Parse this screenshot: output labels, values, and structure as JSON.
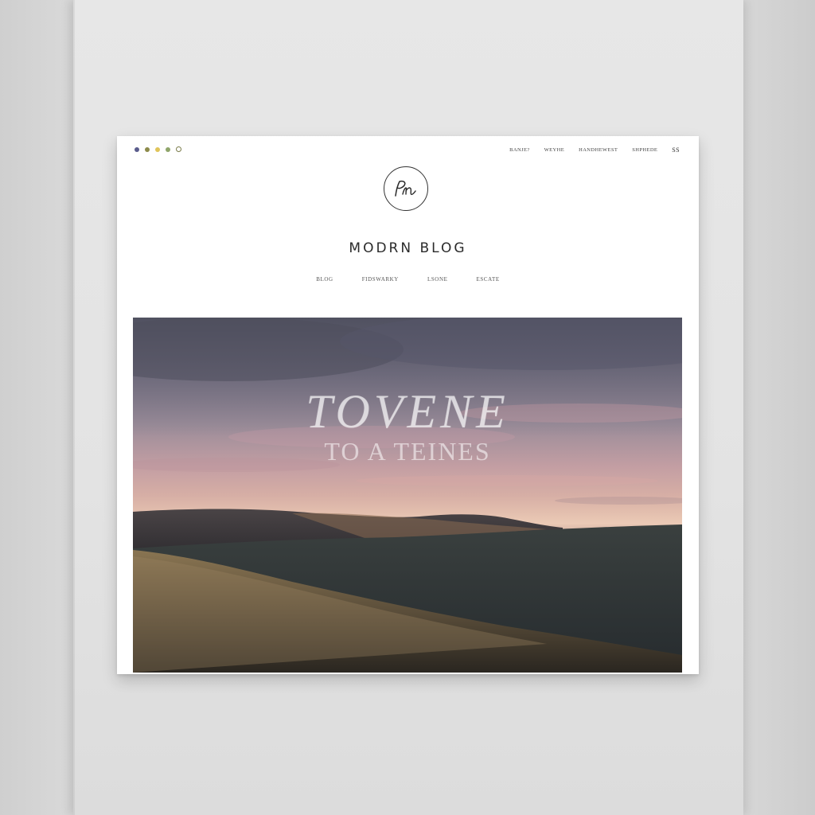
{
  "window": {
    "dots": [
      {
        "name": "dot-purple",
        "color": "#5a5c8c"
      },
      {
        "name": "dot-olive",
        "color": "#8c8a4a"
      },
      {
        "name": "dot-yellow",
        "color": "#e0c45a"
      },
      {
        "name": "dot-green",
        "color": "#8fa56a"
      },
      {
        "name": "dot-ring",
        "color": "#7a7c4a"
      }
    ]
  },
  "topnav": {
    "items": [
      "BANJE?",
      "WEYHE",
      "HANDHEWEST",
      "SHPHEDE"
    ],
    "extra_glyph": "ß"
  },
  "logo": {
    "monogram": "PN"
  },
  "site": {
    "title": "MODRN BLOG"
  },
  "subnav": {
    "items": [
      "BLOG",
      "FIDSWARKY",
      "LSONE",
      "ESCATE"
    ]
  },
  "hero": {
    "title": "TOVENE",
    "subtitle": "TO A TEINES",
    "colors": {
      "sky_top": "#5d5d6e",
      "sky_glow": "#ebcab6",
      "hills_dark": "#2f3338",
      "grass": "#8a7552"
    }
  }
}
